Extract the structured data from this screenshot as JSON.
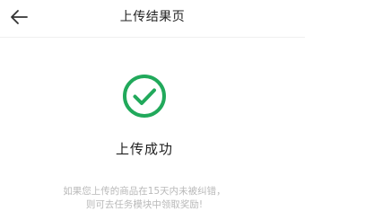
{
  "header": {
    "title": "上传结果页",
    "back_icon": "arrow-left-icon"
  },
  "result": {
    "icon": "check-circle-icon",
    "icon_color": "#21a95b",
    "status_text": "上传成功"
  },
  "hint": {
    "line1": "如果您上传的商品在15天内未被纠错，",
    "line2": "则可去任务模块中领取奖励!"
  }
}
